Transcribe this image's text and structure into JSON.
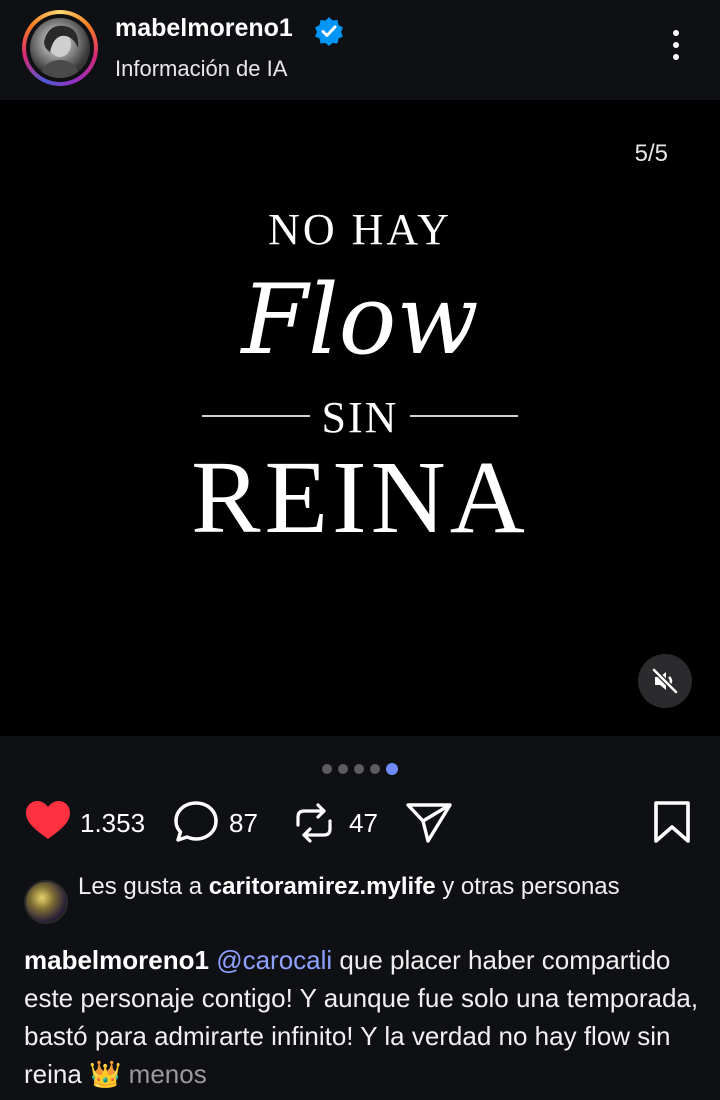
{
  "header": {
    "username": "mabelmoreno1",
    "subtitle": "Información de IA"
  },
  "media": {
    "counter": "5/5",
    "line1": "NO HAY",
    "line2": "Flow",
    "line3": "SIN",
    "line4": "REINA"
  },
  "carousel": {
    "total": 5,
    "active_index": 5
  },
  "actions": {
    "likes": "1.353",
    "comments": "87",
    "reposts": "47"
  },
  "likes_info": {
    "prefix": "Les gusta a ",
    "user": "caritoramirez.mylife",
    "suffix": " y otras personas"
  },
  "caption": {
    "user": "mabelmoreno1",
    "mention": "@carocali",
    "text": " que placer haber compartido este personaje contigo! Y aunque fue solo una temporada, bastó para admirarte infinito! Y la verdad no hay flow sin reina ",
    "emoji": "👑",
    "less": "menos"
  },
  "colors": {
    "background": "#0f1014",
    "heart": "#ff3040",
    "verified": "#0095f6",
    "mention": "#8ea1ff",
    "dot_active": "#6f8bff"
  }
}
